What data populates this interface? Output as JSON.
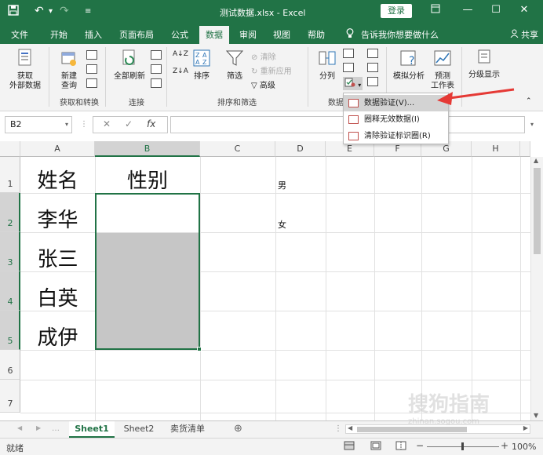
{
  "titlebar": {
    "save_icon": "save-icon",
    "undo_icon": "undo-icon",
    "redo_icon": "redo-icon",
    "title": "测试数据.xlsx - Excel",
    "login": "登录",
    "ribbon_display_icon": "ribbon-display-icon",
    "minimize": "—",
    "maximize": "☐",
    "close": "✕"
  },
  "tabs": [
    {
      "label": "文件"
    },
    {
      "label": "开始"
    },
    {
      "label": "插入"
    },
    {
      "label": "页面布局"
    },
    {
      "label": "公式"
    },
    {
      "label": "数据"
    },
    {
      "label": "审阅"
    },
    {
      "label": "视图"
    },
    {
      "label": "帮助"
    },
    {
      "label": "告诉我你想要做什么"
    }
  ],
  "share": "共享",
  "ribbon": {
    "get_external": "获取\n外部数据",
    "new_query": "新建\n查询",
    "group_get_transform": "获取和转换",
    "refresh_all": "全部刷新",
    "group_connections": "连接",
    "sort": "排序",
    "filter": "筛选",
    "clear": "清除",
    "reapply": "重新应用",
    "advanced": "高级",
    "group_sort_filter": "排序和筛选",
    "text_to_columns": "分列",
    "group_data_tools": "数据",
    "what_if": "模拟分析",
    "forecast_sheet": "预测\n工作表",
    "outline": "分级显示"
  },
  "dropdown": {
    "items": [
      {
        "label": "数据验证(V)..."
      },
      {
        "label": "圈释无效数据(I)"
      },
      {
        "label": "清除验证标识圈(R)"
      }
    ]
  },
  "formula_bar": {
    "name_box": "B2",
    "cancel": "✕",
    "enter": "✓",
    "fx": "fx",
    "formula": ""
  },
  "columns": [
    "A",
    "B",
    "C",
    "D",
    "E",
    "F",
    "G",
    "H"
  ],
  "rows": [
    "1",
    "2",
    "3",
    "4",
    "5",
    "6",
    "7"
  ],
  "cells": {
    "A1": "姓名",
    "B1": "性别",
    "A2": "李华",
    "A3": "张三",
    "A4": "白英",
    "A5": "成伊",
    "D1": "男",
    "D2": "女"
  },
  "sheet_tabs": [
    {
      "label": "Sheet1"
    },
    {
      "label": "Sheet2"
    },
    {
      "label": "卖货清单"
    }
  ],
  "status": {
    "ready": "就绪",
    "zoom": "100%"
  },
  "watermark": "搜狗指南",
  "watermark_url": "zhinan.sogou.com"
}
